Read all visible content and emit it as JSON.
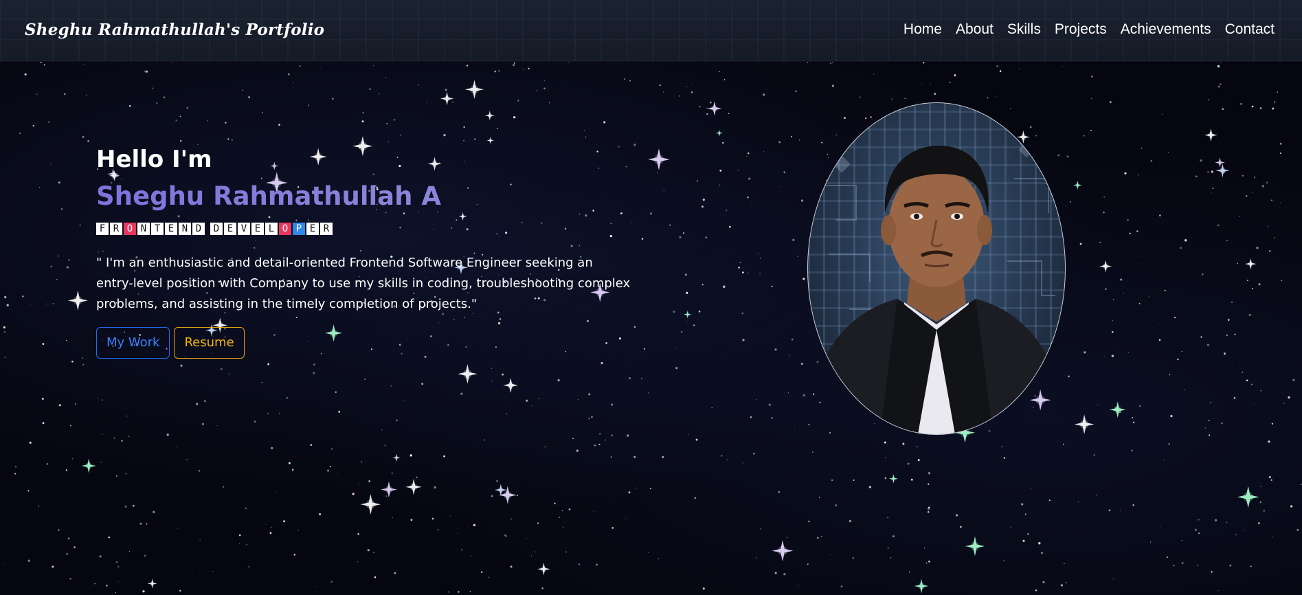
{
  "header": {
    "brand": "Sheghu Rahmathullah's Portfolio",
    "nav": [
      "Home",
      "About",
      "Skills",
      "Projects",
      "Achievements",
      "Contact"
    ]
  },
  "hero": {
    "greeting": "Hello I'm",
    "name": "Sheghu Rahmathullah A",
    "role_letters": [
      {
        "ch": "F",
        "style": "plain"
      },
      {
        "ch": "R",
        "style": "plain"
      },
      {
        "ch": "O",
        "style": "red"
      },
      {
        "ch": "N",
        "style": "plain"
      },
      {
        "ch": "T",
        "style": "plain"
      },
      {
        "ch": "E",
        "style": "plain"
      },
      {
        "ch": "N",
        "style": "plain"
      },
      {
        "ch": "D",
        "style": "plain"
      },
      {
        "ch": " ",
        "style": "gap"
      },
      {
        "ch": "D",
        "style": "plain"
      },
      {
        "ch": "E",
        "style": "plain"
      },
      {
        "ch": "V",
        "style": "plain"
      },
      {
        "ch": "E",
        "style": "plain"
      },
      {
        "ch": "L",
        "style": "plain"
      },
      {
        "ch": "O",
        "style": "red"
      },
      {
        "ch": "P",
        "style": "blue"
      },
      {
        "ch": "E",
        "style": "plain"
      },
      {
        "ch": "R",
        "style": "plain"
      }
    ],
    "summary": "\" I'm an enthusiastic and detail-oriented Frontend Software Engineer seeking an entry-level position with Company to use my skills in coding, troubleshooting complex problems, and assisting in the timely completion of projects.\"",
    "buttons": {
      "work": "My Work",
      "resume": "Resume"
    },
    "photo_icon": "profile-photo"
  },
  "colors": {
    "background": "#05060f",
    "name_gradient": "#7f72dc",
    "highlight_red": "#e8365e",
    "highlight_blue": "#2f88e6",
    "button_work": "#1f6ef5",
    "button_resume": "#e6a712"
  }
}
